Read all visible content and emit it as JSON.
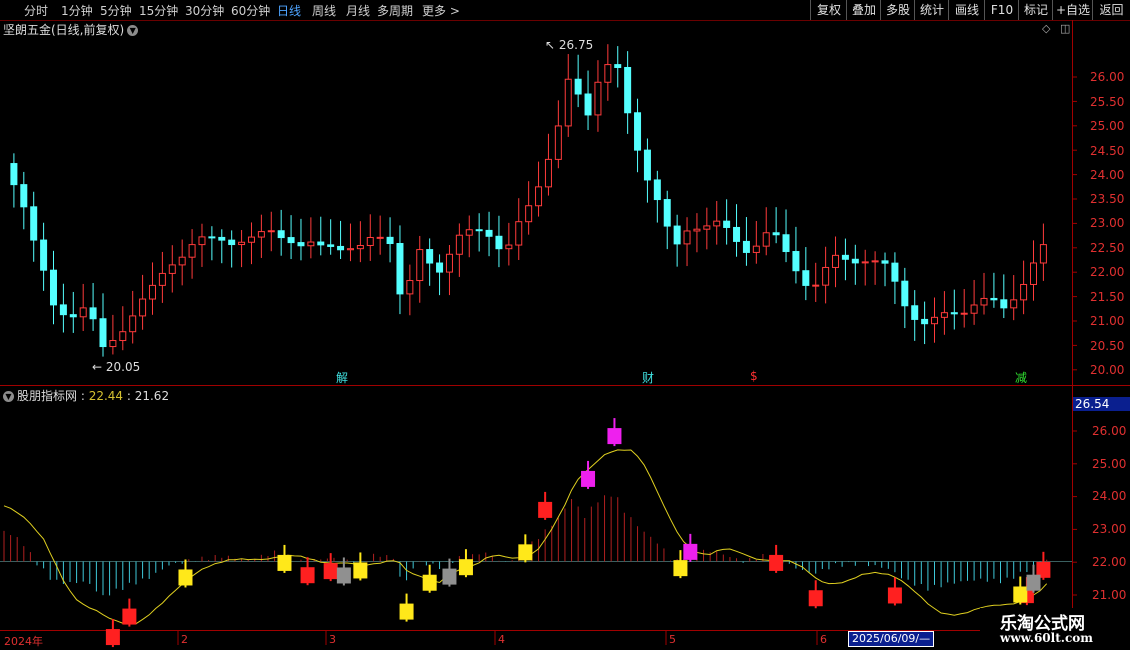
{
  "toolbar": {
    "periods": [
      "分时",
      "1分钟",
      "5分钟",
      "15分钟",
      "30分钟",
      "60分钟",
      "日线",
      "周线",
      "月线",
      "多周期",
      "更多 >"
    ],
    "active_period": 6,
    "buttons": [
      "复权",
      "叠加",
      "多股",
      "统计",
      "画线",
      "F10",
      "标记",
      "+自选",
      "返回"
    ]
  },
  "main": {
    "title": "坚朗五金(日线,前复权)",
    "y_ticks": [
      "26.00",
      "25.50",
      "25.00",
      "24.50",
      "24.00",
      "23.50",
      "23.00",
      "22.50",
      "22.00",
      "21.50",
      "21.00",
      "20.50",
      "20.00"
    ],
    "high_label": "26.75",
    "low_label": "20.05",
    "markers": [
      {
        "text": "解",
        "color": "#40e0e0"
      },
      {
        "text": "财",
        "color": "#40e0e0"
      },
      {
        "text": "$",
        "color": "#ff3030"
      },
      {
        "text": "减",
        "color": "#30e030"
      }
    ]
  },
  "indicator": {
    "name": "股朋指标网",
    "value1": "22.44",
    "value2": "21.62",
    "value_box": "26.54",
    "y_ticks": [
      "26.00",
      "25.00",
      "24.00",
      "23.00",
      "22.00",
      "21.00"
    ]
  },
  "timeline": {
    "labels": [
      "2024年",
      "2",
      "3",
      "4",
      "5",
      "6"
    ],
    "cursor": "2025/06/09/—"
  },
  "watermark": {
    "title": "乐淘公式网",
    "url": "www.60lt.com"
  },
  "chart_data": {
    "type": "candlestick",
    "title": "坚朗五金(日线,前复权)",
    "ylim": [
      19.8,
      26.9
    ],
    "max_price": 26.75,
    "min_price": 20.05,
    "series": [
      {
        "name": "日线",
        "values": []
      }
    ]
  }
}
